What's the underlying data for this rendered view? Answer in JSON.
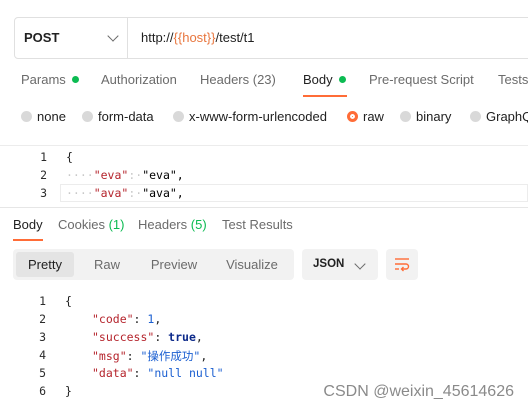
{
  "request": {
    "method": "POST",
    "url_prefix": "http://",
    "url_var": "{{host}}",
    "url_suffix": "/test/t1"
  },
  "request_tabs": [
    {
      "label": "Params",
      "indicator": true
    },
    {
      "label": "Authorization"
    },
    {
      "label": "Headers (23)"
    },
    {
      "label": "Body",
      "indicator": true,
      "active": true
    },
    {
      "label": "Pre-request Script"
    },
    {
      "label": "Tests"
    }
  ],
  "body_types": [
    {
      "label": "none"
    },
    {
      "label": "form-data"
    },
    {
      "label": "x-www-form-urlencoded"
    },
    {
      "label": "raw",
      "selected": true
    },
    {
      "label": "binary"
    },
    {
      "label": "GraphQL"
    }
  ],
  "request_body": {
    "line_numbers": [
      "1",
      "2",
      "3"
    ],
    "lines": [
      {
        "text": "{"
      },
      {
        "ws": "····",
        "key": "\"eva\"",
        "colon": ":·",
        "value": "\"eva\","
      },
      {
        "ws": "····",
        "key": "\"ava\"",
        "colon": ":·",
        "value": "\"ava\","
      }
    ]
  },
  "response_tabs": [
    {
      "label": "Body",
      "active": true
    },
    {
      "label": "Cookies",
      "count": "(1)"
    },
    {
      "label": "Headers",
      "count": "(5)"
    },
    {
      "label": "Test Results"
    }
  ],
  "view_modes": [
    "Pretty",
    "Raw",
    "Preview",
    "Visualize"
  ],
  "active_view": "Pretty",
  "format": "JSON",
  "response_body": {
    "line_numbers": [
      "1",
      "2",
      "3",
      "4",
      "5",
      "6"
    ],
    "open": "{",
    "close": "}",
    "entries": [
      {
        "key": "\"code\"",
        "value": "1",
        "type": "number",
        "comma": ","
      },
      {
        "key": "\"success\"",
        "value": "true",
        "type": "bool",
        "comma": ","
      },
      {
        "key": "\"msg\"",
        "value": "\"操作成功\"",
        "type": "string",
        "comma": ","
      },
      {
        "key": "\"data\"",
        "value": "\"null null\"",
        "type": "string",
        "comma": ""
      }
    ]
  },
  "watermark": "CSDN @weixin_45614626",
  "colors": {
    "accent": "#ff6c37",
    "success": "#0cbb52",
    "string": "#b5242c"
  }
}
